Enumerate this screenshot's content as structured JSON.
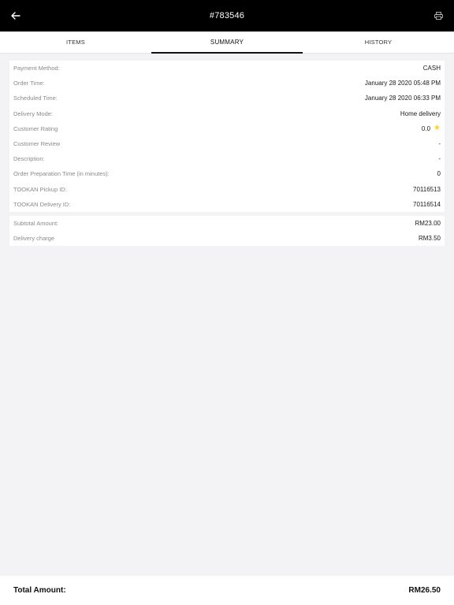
{
  "header": {
    "title": "#783546",
    "back_icon": "arrow-left-icon",
    "print_icon": "printer-icon"
  },
  "tabs": [
    {
      "label": "ITEMS",
      "active": false
    },
    {
      "label": "SUMMARY",
      "active": true
    },
    {
      "label": "HISTORY",
      "active": false
    }
  ],
  "details": [
    {
      "label": "Payment Method:",
      "value": "CASH"
    },
    {
      "label": "Order Time:",
      "value": "January 28 2020 05:48 PM"
    },
    {
      "label": "Scheduled Time:",
      "value": "January 28 2020 06:33 PM"
    },
    {
      "label": "Delivery Mode:",
      "value": "Home delivery"
    },
    {
      "label": "Customer Rating",
      "value": "0.0"
    },
    {
      "label": "Customer Review",
      "value": "-"
    },
    {
      "label": "Description:",
      "value": "-"
    },
    {
      "label": "Order Preparation Time (in minutes):",
      "value": "0"
    },
    {
      "label": "TOOKAN Pickup ID:",
      "value": "70116513"
    },
    {
      "label": "TOOKAN Delivery ID:",
      "value": "70116514"
    }
  ],
  "amounts": [
    {
      "label": "Subtotal Amount:",
      "value": "RM23.00"
    },
    {
      "label": "Delivery charge",
      "value": "RM3.50"
    }
  ],
  "total": {
    "label": "Total Amount:",
    "value": "RM26.50"
  },
  "colors": {
    "header_bg": "#000000",
    "background": "#f3f3f6",
    "label": "#8a8a8e",
    "star": "#f7d51d"
  }
}
